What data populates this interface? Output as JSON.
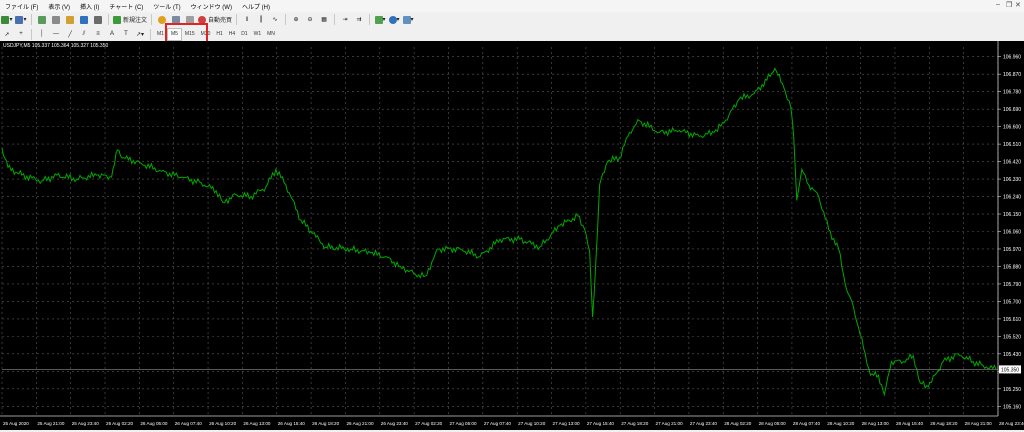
{
  "menu": [
    "ファイル (F)",
    "表示 (V)",
    "挿入 (I)",
    "チャート (C)",
    "ツール (T)",
    "ウィンドウ (W)",
    "ヘルプ (H)"
  ],
  "toolbar": {
    "new_order": "新規注文",
    "auto_trading": "自動売買",
    "timeframes": [
      "M1",
      "M5",
      "M15",
      "M30",
      "H1",
      "H4",
      "D1",
      "W1",
      "MN"
    ],
    "active_timeframe": "M5"
  },
  "chart": {
    "symbol_info": "USDJPY,M5  105.337 105.364 105.327 105.350",
    "price_labels": [
      "106.960",
      "106.870",
      "106.780",
      "106.690",
      "106.600",
      "106.510",
      "106.420",
      "106.330",
      "106.240",
      "106.150",
      "106.060",
      "105.970",
      "105.880",
      "105.790",
      "105.700",
      "105.610",
      "105.520",
      "105.430",
      "105.340",
      "105.250",
      "105.160"
    ],
    "current_price": "105.350",
    "time_labels": [
      "25 Aug 2020",
      "25 Aug 21:00",
      "25 Aug 23:40",
      "26 Aug 02:20",
      "26 Aug 05:00",
      "26 Aug 07:40",
      "26 Aug 10:20",
      "26 Aug 13:00",
      "26 Aug 15:40",
      "26 Aug 18:20",
      "26 Aug 21:00",
      "26 Aug 23:40",
      "27 Aug 02:20",
      "27 Aug 05:00",
      "27 Aug 07:40",
      "27 Aug 10:20",
      "27 Aug 13:00",
      "27 Aug 15:40",
      "27 Aug 18:20",
      "27 Aug 21:00",
      "27 Aug 23:40",
      "28 Aug 02:20",
      "28 Aug 05:00",
      "28 Aug 07:40",
      "28 Aug 10:20",
      "28 Aug 13:00",
      "28 Aug 15:40",
      "28 Aug 18:20",
      "28 Aug 21:00",
      "28 Aug 23:40"
    ],
    "colors": {
      "background": "#000000",
      "line": "#00a800",
      "grid": "#5a5a5a",
      "highlight": "#e02424"
    }
  },
  "chart_data": {
    "type": "line",
    "series": [
      {
        "name": "USDJPY,M5",
        "points": [
          [
            0,
            106.49
          ],
          [
            6,
            106.39
          ],
          [
            20,
            106.35
          ],
          [
            40,
            106.32
          ],
          [
            55,
            106.35
          ],
          [
            75,
            106.33
          ],
          [
            95,
            106.35
          ],
          [
            110,
            106.34
          ],
          [
            116,
            106.48
          ],
          [
            122,
            106.44
          ],
          [
            140,
            106.41
          ],
          [
            160,
            106.37
          ],
          [
            180,
            106.34
          ],
          [
            200,
            106.31
          ],
          [
            215,
            106.27
          ],
          [
            222,
            106.21
          ],
          [
            235,
            106.25
          ],
          [
            250,
            106.24
          ],
          [
            265,
            106.29
          ],
          [
            275,
            106.38
          ],
          [
            285,
            106.3
          ],
          [
            300,
            106.12
          ],
          [
            312,
            106.05
          ],
          [
            325,
            105.98
          ],
          [
            350,
            105.97
          ],
          [
            370,
            105.95
          ],
          [
            385,
            105.93
          ],
          [
            400,
            105.88
          ],
          [
            415,
            105.84
          ],
          [
            425,
            105.83
          ],
          [
            438,
            105.97
          ],
          [
            460,
            105.97
          ],
          [
            480,
            105.93
          ],
          [
            500,
            106.02
          ],
          [
            520,
            106.02
          ],
          [
            540,
            105.98
          ],
          [
            560,
            106.09
          ],
          [
            578,
            106.14
          ],
          [
            585,
            106.07
          ],
          [
            590,
            105.96
          ],
          [
            593,
            105.62
          ],
          [
            596,
            105.88
          ],
          [
            600,
            106.3
          ],
          [
            608,
            106.42
          ],
          [
            620,
            106.44
          ],
          [
            630,
            106.57
          ],
          [
            640,
            106.63
          ],
          [
            660,
            106.57
          ],
          [
            680,
            106.58
          ],
          [
            700,
            106.55
          ],
          [
            715,
            106.57
          ],
          [
            725,
            106.62
          ],
          [
            740,
            106.74
          ],
          [
            755,
            106.77
          ],
          [
            768,
            106.84
          ],
          [
            776,
            106.9
          ],
          [
            785,
            106.8
          ],
          [
            792,
            106.7
          ],
          [
            795,
            106.54
          ],
          [
            798,
            106.22
          ],
          [
            803,
            106.38
          ],
          [
            810,
            106.3
          ],
          [
            820,
            106.24
          ],
          [
            830,
            106.07
          ],
          [
            840,
            105.97
          ],
          [
            848,
            105.76
          ],
          [
            855,
            105.67
          ],
          [
            865,
            105.46
          ],
          [
            872,
            105.32
          ],
          [
            880,
            105.32
          ],
          [
            886,
            105.22
          ],
          [
            893,
            105.39
          ],
          [
            905,
            105.39
          ],
          [
            915,
            105.42
          ],
          [
            922,
            105.28
          ],
          [
            930,
            105.26
          ],
          [
            945,
            105.39
          ],
          [
            960,
            105.43
          ],
          [
            975,
            105.39
          ],
          [
            985,
            105.37
          ],
          [
            998,
            105.35
          ]
        ]
      }
    ],
    "x_unit": "chart pixels (time axis)",
    "ylim": [
      105.11,
      107.01
    ],
    "grid": true,
    "xlabel": "",
    "ylabel": ""
  }
}
